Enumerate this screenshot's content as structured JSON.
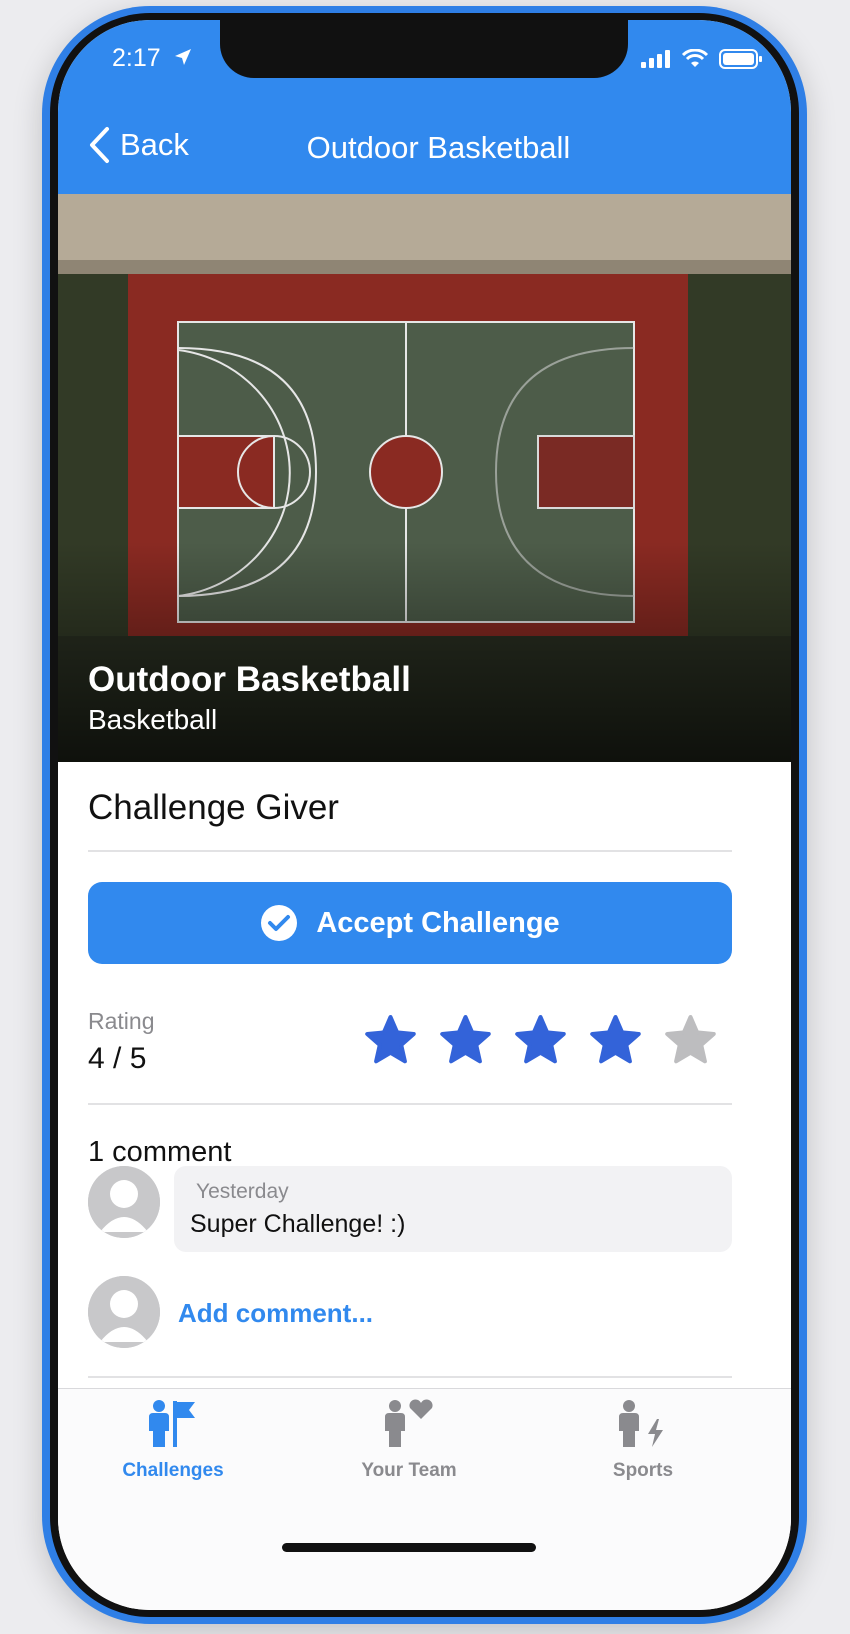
{
  "status_bar": {
    "time": "2:17"
  },
  "nav": {
    "back_label": "Back",
    "title": "Outdoor Basketball"
  },
  "hero": {
    "title": "Outdoor Basketball",
    "subtitle": "Basketball"
  },
  "section": {
    "giver_label": "Challenge Giver"
  },
  "accept_button": {
    "label": "Accept Challenge"
  },
  "rating": {
    "label": "Rating",
    "value_text": "4 / 5",
    "value": 4,
    "max": 5
  },
  "comments": {
    "count_label": "1 comment",
    "items": [
      {
        "time": "Yesterday",
        "text": "Super Challenge! :)"
      }
    ],
    "add_label": "Add comment..."
  },
  "tabs": [
    {
      "label": "Challenges",
      "active": true,
      "icon": "challenges-icon"
    },
    {
      "label": "Your Team",
      "active": false,
      "icon": "team-heart-icon"
    },
    {
      "label": "Sports",
      "active": false,
      "icon": "sports-bolt-icon"
    }
  ],
  "colors": {
    "accent": "#3189ee",
    "star_filled": "#3363d9",
    "star_empty": "#bdbdbf",
    "tab_inactive": "#8a8a8e"
  }
}
